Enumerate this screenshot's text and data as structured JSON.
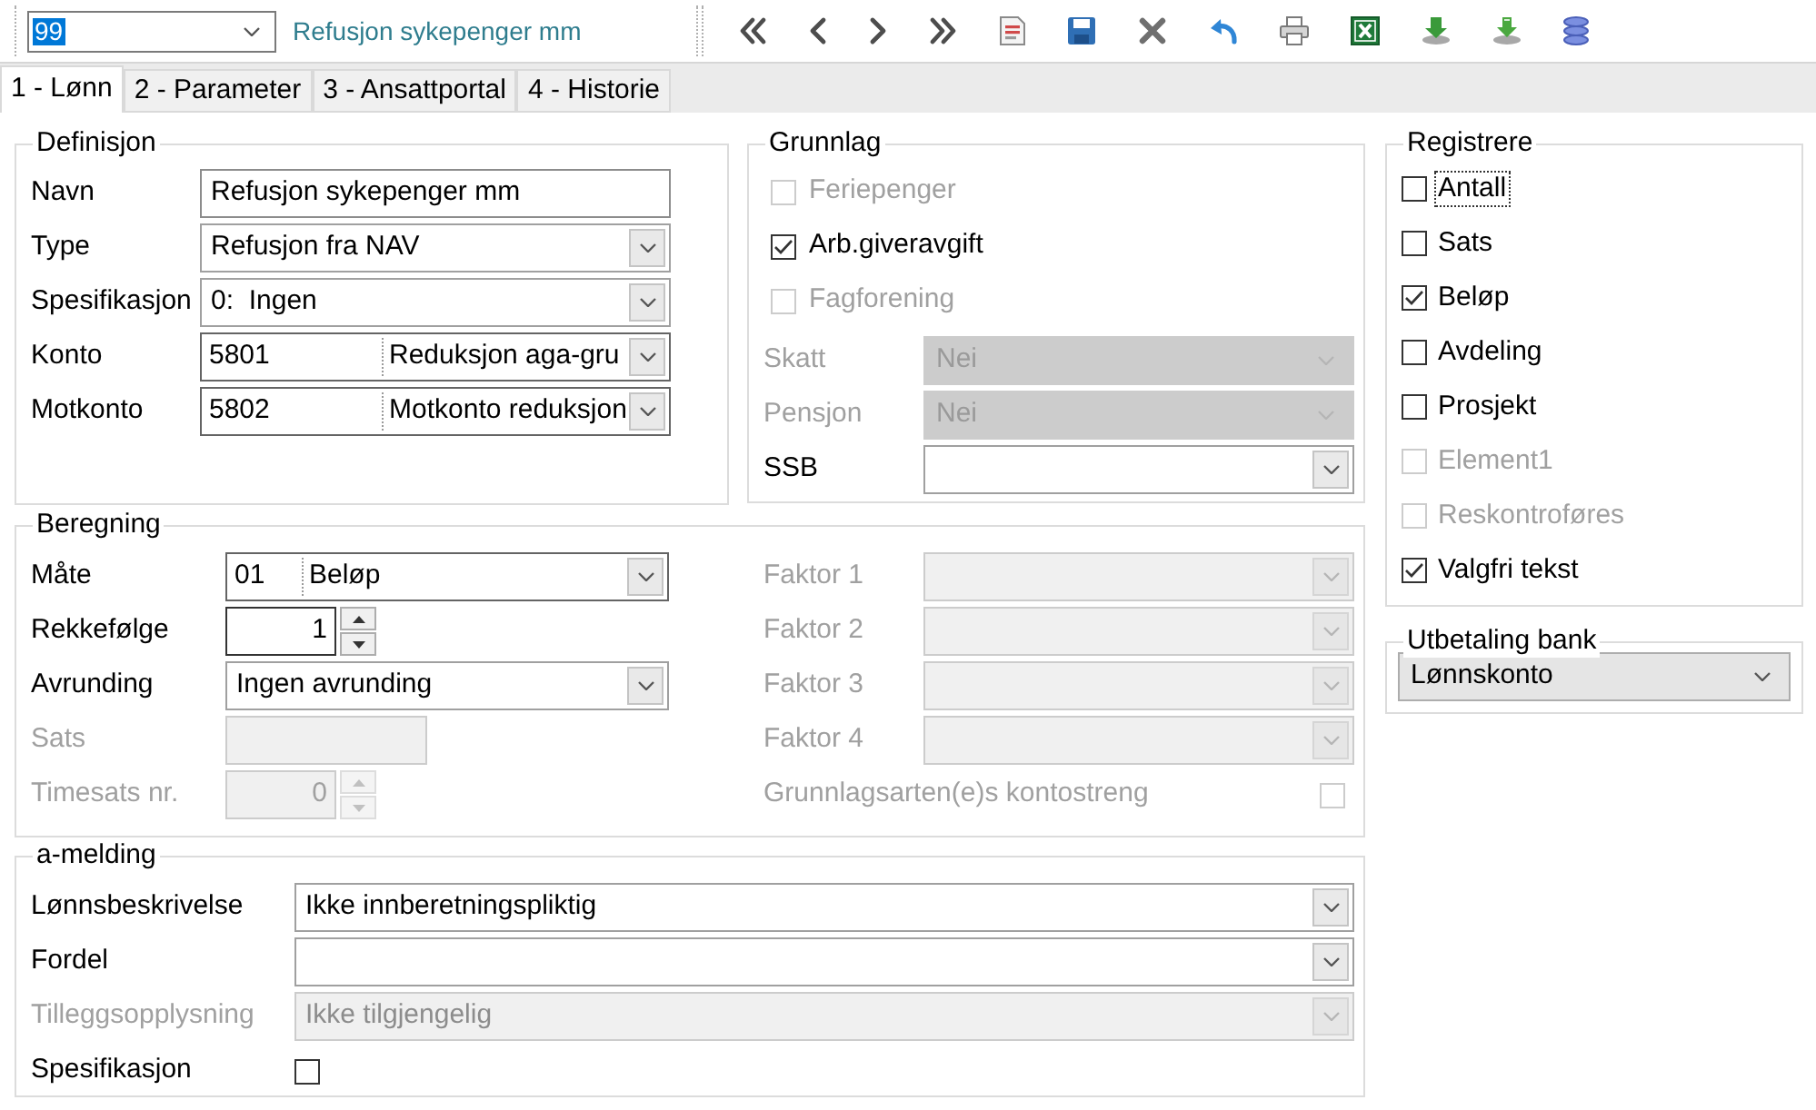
{
  "toolbar": {
    "record": {
      "value": "99",
      "highlighted": true
    },
    "record_name": "Refusjon sykepenger mm"
  },
  "tabs": [
    {
      "label": "1 - Lønn",
      "selected": true
    },
    {
      "label": "2 - Parameter",
      "selected": false
    },
    {
      "label": "3 - Ansattportal",
      "selected": false
    },
    {
      "label": "4 - Historie",
      "selected": false
    }
  ],
  "definisjon": {
    "title": "Definisjon",
    "fields": [
      {
        "kind": "text",
        "label": "Navn",
        "value": "Refusjon sykepenger mm",
        "disabled": false
      },
      {
        "kind": "combo",
        "label": "Type",
        "value": "Refusjon fra NAV",
        "disabled": false
      },
      {
        "kind": "combo",
        "label": "Spesifikasjon",
        "value": "0:  Ingen",
        "disabled": false
      },
      {
        "kind": "code_combo",
        "label": "Konto",
        "code": "5801",
        "value": "Reduksjon aga-gru",
        "disabled": false
      },
      {
        "kind": "code_combo",
        "label": "Motkonto",
        "code": "5802",
        "value": "Motkonto reduksjon",
        "disabled": false
      }
    ]
  },
  "grunnlag": {
    "title": "Grunnlag",
    "checkboxes": [
      {
        "label": "Feriepenger",
        "checked": false,
        "disabled": true
      },
      {
        "label": "Arb.giveravgift",
        "checked": true,
        "disabled": false
      },
      {
        "label": "Fagforening",
        "checked": false,
        "disabled": true
      }
    ],
    "fields": [
      {
        "kind": "dropdown_list",
        "label": "Skatt",
        "value": "Nei",
        "disabled": true
      },
      {
        "kind": "dropdown_list",
        "label": "Pensjon",
        "value": "Nei",
        "disabled": true
      },
      {
        "kind": "combo",
        "label": "SSB",
        "disabled": false
      }
    ]
  },
  "registrere": {
    "title": "Registrere",
    "items": [
      {
        "label": "Antall",
        "checked": false,
        "disabled": false,
        "focused": true
      },
      {
        "label": "Sats",
        "checked": false,
        "disabled": false,
        "focused": false
      },
      {
        "label": "Beløp",
        "checked": true,
        "disabled": false,
        "focused": false
      },
      {
        "label": "Avdeling",
        "checked": false,
        "disabled": false,
        "focused": false
      },
      {
        "label": "Prosjekt",
        "checked": false,
        "disabled": false,
        "focused": false
      },
      {
        "label": "Element1",
        "checked": false,
        "disabled": true,
        "focused": false
      },
      {
        "label": "Reskontroføres",
        "checked": false,
        "disabled": true,
        "focused": false
      },
      {
        "label": "Valgfri tekst",
        "checked": true,
        "disabled": false,
        "focused": false
      }
    ]
  },
  "utbetaling_bank": {
    "title": "Utbetaling bank",
    "field": {
      "kind": "dropdown_list",
      "value": "Lønnskonto",
      "disabled": false
    }
  },
  "beregning": {
    "title": "Beregning",
    "left": [
      {
        "kind": "code_combo",
        "label": "Måte",
        "code": "01",
        "value": "Beløp",
        "disabled": false
      },
      {
        "kind": "spinner",
        "label": "Rekkefølge",
        "value": "1",
        "disabled": false
      },
      {
        "kind": "combo",
        "label": "Avrunding",
        "value": "Ingen avrunding",
        "disabled": false
      },
      {
        "kind": "text",
        "label": "Sats",
        "disabled": true
      },
      {
        "kind": "spinner",
        "label": "Timesats nr.",
        "value": "0",
        "disabled": true
      }
    ],
    "right": [
      {
        "kind": "combo",
        "label": "Faktor 1",
        "disabled": true
      },
      {
        "kind": "combo",
        "label": "Faktor 2",
        "disabled": true
      },
      {
        "kind": "combo",
        "label": "Faktor 3",
        "disabled": true
      },
      {
        "kind": "combo",
        "label": "Faktor 4",
        "disabled": true
      },
      {
        "kind": "checkbox",
        "label": "Grunnlagsarten(e)s kontostreng",
        "checked": false,
        "disabled": true
      }
    ]
  },
  "a_melding": {
    "title": "a-melding",
    "fields": [
      {
        "kind": "combo",
        "label": "Lønnsbeskrivelse",
        "value": "Ikke innberetningspliktig",
        "disabled": false
      },
      {
        "kind": "combo",
        "label": "Fordel",
        "disabled": false
      },
      {
        "kind": "combo",
        "label": "Tilleggsopplysning",
        "value": "Ikke tilgjengelig",
        "disabled": true
      },
      {
        "kind": "checkbox",
        "label": "Spesifikasjon",
        "checked": false,
        "disabled": false
      }
    ]
  }
}
